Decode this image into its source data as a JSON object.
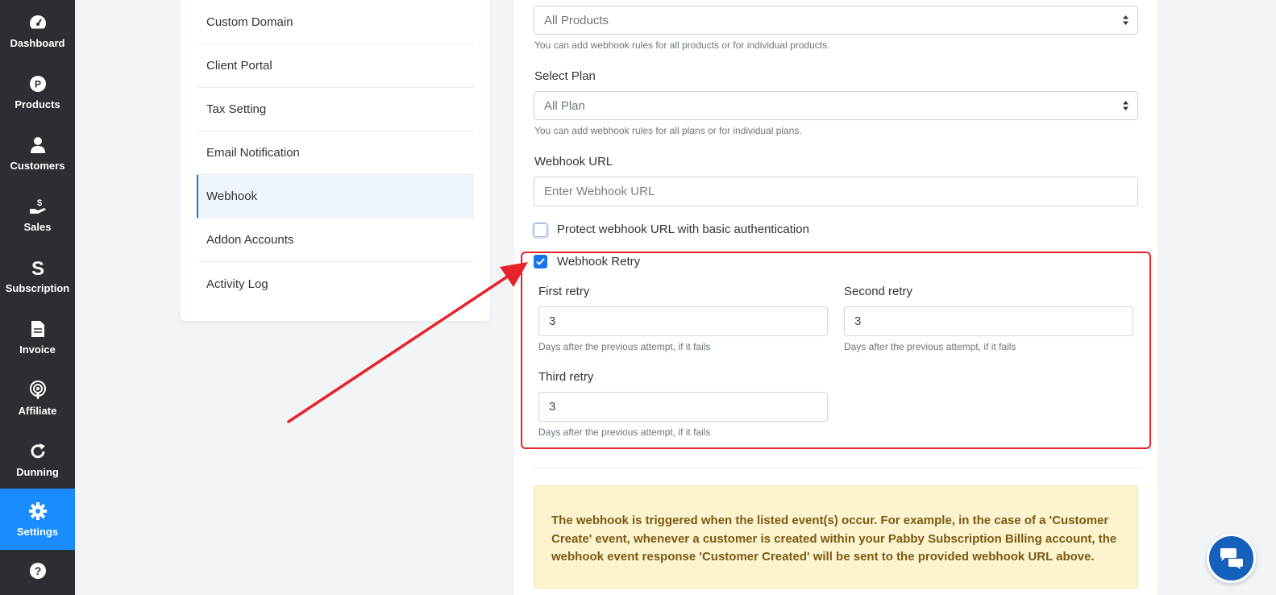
{
  "sidebar": {
    "items": [
      {
        "label": "Dashboard",
        "icon": "dashboard-icon"
      },
      {
        "label": "Products",
        "icon": "products-icon"
      },
      {
        "label": "Customers",
        "icon": "customers-icon"
      },
      {
        "label": "Sales",
        "icon": "sales-icon"
      },
      {
        "label": "Subscription",
        "icon": "subscription-icon"
      },
      {
        "label": "Invoice",
        "icon": "invoice-icon"
      },
      {
        "label": "Affiliate",
        "icon": "affiliate-icon"
      },
      {
        "label": "Dunning",
        "icon": "dunning-icon"
      },
      {
        "label": "Settings",
        "icon": "gear-icon"
      },
      {
        "label": "",
        "icon": "help-icon"
      }
    ],
    "active": "Settings",
    "active_color": "#1a8cff",
    "background": "#2b2f33"
  },
  "settings_menu": {
    "items": [
      {
        "label": "Custom Domain"
      },
      {
        "label": "Client Portal"
      },
      {
        "label": "Tax Setting"
      },
      {
        "label": "Email Notification"
      },
      {
        "label": "Webhook"
      },
      {
        "label": "Addon Accounts"
      },
      {
        "label": "Activity Log"
      }
    ],
    "active": "Webhook"
  },
  "form": {
    "product_select": {
      "value": "All Products",
      "help": "You can add webhook rules for all products or for individual products."
    },
    "plan": {
      "label": "Select Plan",
      "value": "All Plan",
      "help": "You can add webhook rules for all plans or for individual plans."
    },
    "webhook_url": {
      "label": "Webhook URL",
      "placeholder": "Enter Webhook URL",
      "value": ""
    },
    "basic_auth": {
      "label": "Protect webhook URL with basic authentication",
      "checked": false
    },
    "retry": {
      "label": "Webhook Retry",
      "checked": true,
      "first": {
        "label": "First retry",
        "value": "3",
        "help": "Days after the previous attempt, if it fails"
      },
      "second": {
        "label": "Second retry",
        "value": "3",
        "help": "Days after the previous attempt, if it fails"
      },
      "third": {
        "label": "Third retry",
        "value": "3",
        "help": "Days after the previous attempt, if it fails"
      }
    }
  },
  "notice": {
    "text": "The webhook is triggered when the listed event(s) occur. For example, in the case of a 'Customer Create' event, whenever a customer is created within your Pabby Subscription Billing account, the webhook event response 'Customer Created' will be sent to the provided webhook URL above."
  },
  "annotation": {
    "color": "#e8222a",
    "icon": "red-arrow"
  },
  "chat": {
    "icon": "chat-icon",
    "color": "#1560bd"
  }
}
